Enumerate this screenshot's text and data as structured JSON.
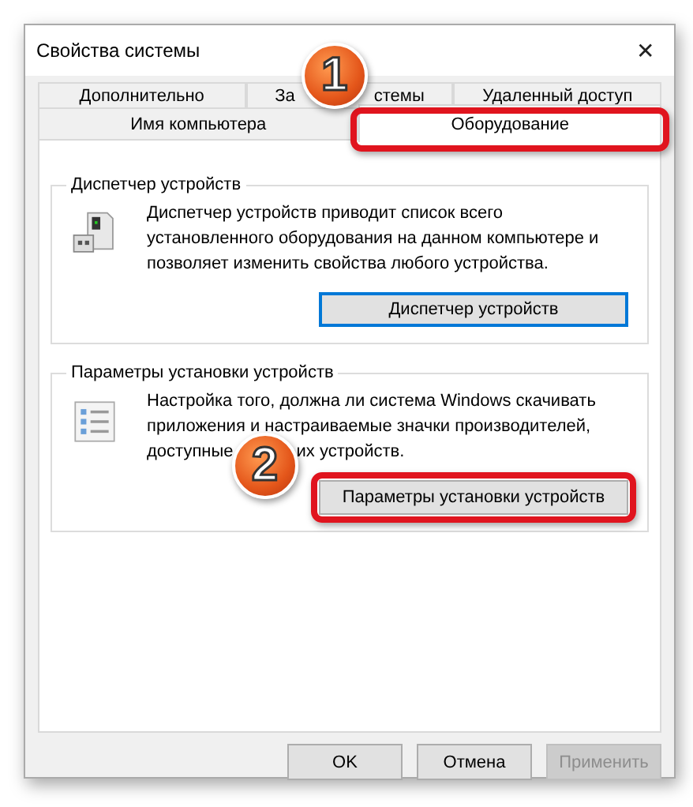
{
  "window": {
    "title": "Свойства системы",
    "close": "✕"
  },
  "tabs": [
    [
      {
        "label": "Дополнительно",
        "selected": false
      },
      {
        "label": "За",
        "label_tail": "стемы",
        "selected": false
      },
      {
        "label": "Удаленный доступ",
        "selected": false
      }
    ],
    [
      {
        "label": "Имя компьютера",
        "selected": false
      },
      {
        "label": "Оборудование",
        "selected": true
      }
    ]
  ],
  "groups": [
    {
      "title": "Диспетчер устройств",
      "lines": [
        [
          "Диспетчер устройств приводит список всего"
        ],
        [
          "установленного оборудования на данном компьютере и"
        ],
        [
          "позволяет изменить свойства любого устройства."
        ]
      ],
      "button": {
        "label": "Диспетчер устройств",
        "focused": true
      }
    },
    {
      "title": "Параметры установки устройств",
      "lines": [
        [
          "Настройка того, должна ли система Windows скачивать"
        ],
        [
          "приложения и настраиваемые значки производителей,"
        ],
        [
          "доступные",
          "их устройств."
        ]
      ],
      "button": {
        "label": "Параметры установки устройств",
        "focused": false
      }
    }
  ],
  "buttons": [
    {
      "label": "OK",
      "disabled": false
    },
    {
      "label": "Отмена",
      "disabled": false
    },
    {
      "label": "Применить",
      "disabled": true
    }
  ],
  "callouts": [
    {
      "number": "1"
    },
    {
      "number": "2"
    }
  ]
}
